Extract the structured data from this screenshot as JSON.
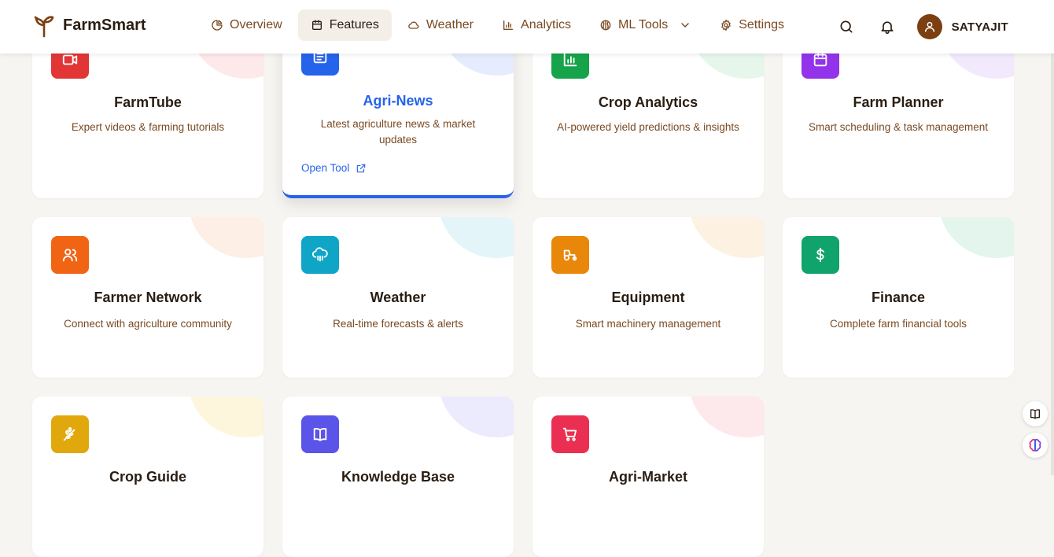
{
  "brand": {
    "name": "FarmSmart",
    "logo_icon": "sprout-icon"
  },
  "nav": {
    "items": [
      {
        "label": "Overview",
        "icon": "pie-chart-icon"
      },
      {
        "label": "Features",
        "icon": "calendar-icon",
        "active": true
      },
      {
        "label": "Weather",
        "icon": "cloud-icon"
      },
      {
        "label": "Analytics",
        "icon": "bar-chart-icon"
      },
      {
        "label": "ML Tools",
        "icon": "brain-icon",
        "has_dropdown": true
      },
      {
        "label": "Settings",
        "icon": "gear-icon"
      }
    ]
  },
  "user": {
    "name": "SATYAJIT",
    "avatar_color": "#7b3f12"
  },
  "cards": [
    {
      "title": "FarmTube",
      "desc": "Expert videos & farming tutorials",
      "icon": "video-icon",
      "color": "#e23636"
    },
    {
      "title": "Agri-News",
      "desc": "Latest agriculture news & market updates",
      "icon": "newspaper-icon",
      "color": "#2563eb",
      "hovered": true,
      "action": "Open Tool"
    },
    {
      "title": "Crop Analytics",
      "desc": "AI-powered yield predictions & insights",
      "icon": "chart-icon",
      "color": "#16a34a"
    },
    {
      "title": "Farm Planner",
      "desc": "Smart scheduling & task management",
      "icon": "calendar-icon",
      "color": "#9333ea"
    },
    {
      "title": "Farmer Network",
      "desc": "Connect with agriculture community",
      "icon": "users-icon",
      "color": "#f06414"
    },
    {
      "title": "Weather",
      "desc": "Real-time forecasts & alerts",
      "icon": "cloud-rain-icon",
      "color": "#0ea5c6"
    },
    {
      "title": "Equipment",
      "desc": "Smart machinery management",
      "icon": "tractor-icon",
      "color": "#e8870a"
    },
    {
      "title": "Finance",
      "desc": "Complete farm financial tools",
      "icon": "dollar-icon",
      "color": "#10a36b"
    },
    {
      "title": "Crop Guide",
      "desc": "",
      "icon": "wheat-icon",
      "color": "#e0a80c"
    },
    {
      "title": "Knowledge Base",
      "desc": "",
      "icon": "book-icon",
      "color": "#5b54e8"
    },
    {
      "title": "Agri-Market",
      "desc": "",
      "icon": "cart-icon",
      "color": "#ea2f52"
    }
  ],
  "floating": [
    {
      "icon": "book-icon"
    },
    {
      "icon": "brain-icon"
    }
  ]
}
